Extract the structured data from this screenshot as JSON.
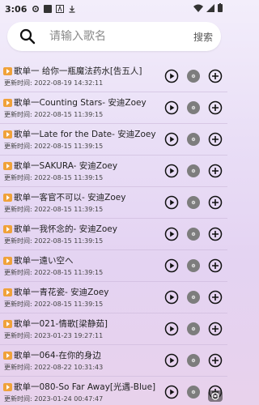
{
  "status": {
    "time": "3:06"
  },
  "search": {
    "placeholder": "请输入歌名",
    "button": "搜索"
  },
  "songs": [
    {
      "title": "歌单一 给你一瓶魔法药水[告五人]",
      "time": "更新时间: 2022-08-19 14:32:11"
    },
    {
      "title": "歌单一Counting Stars- 安迪Zoey",
      "time": "更新时间: 2022-08-15 11:39:15"
    },
    {
      "title": "歌单一Late for the Date- 安迪Zoey",
      "time": "更新时间: 2022-08-15 11:39:15"
    },
    {
      "title": "歌单一SAKURA- 安迪Zoey",
      "time": "更新时间: 2022-08-15 11:39:15"
    },
    {
      "title": "歌单一客官不可以- 安迪Zoey",
      "time": "更新时间: 2022-08-15 11:39:15"
    },
    {
      "title": "歌单一我怀念的- 安迪Zoey",
      "time": "更新时间: 2022-08-15 11:39:15"
    },
    {
      "title": "歌单一遠い空へ",
      "time": "更新时间: 2022-08-15 11:39:15"
    },
    {
      "title": "歌单一青花瓷- 安迪Zoey",
      "time": "更新时间: 2022-08-15 11:39:15"
    },
    {
      "title": "歌单一021-情歌[梁静茹]",
      "time": "更新时间: 2023-01-23 19:27:11"
    },
    {
      "title": "歌单一064-在你的身边",
      "time": "更新时间: 2022-08-22 10:31:43"
    },
    {
      "title": "歌单一080-So Far Away[光遇-Blue]",
      "time": "更新时间: 2023-01-24 00:47:47"
    }
  ]
}
